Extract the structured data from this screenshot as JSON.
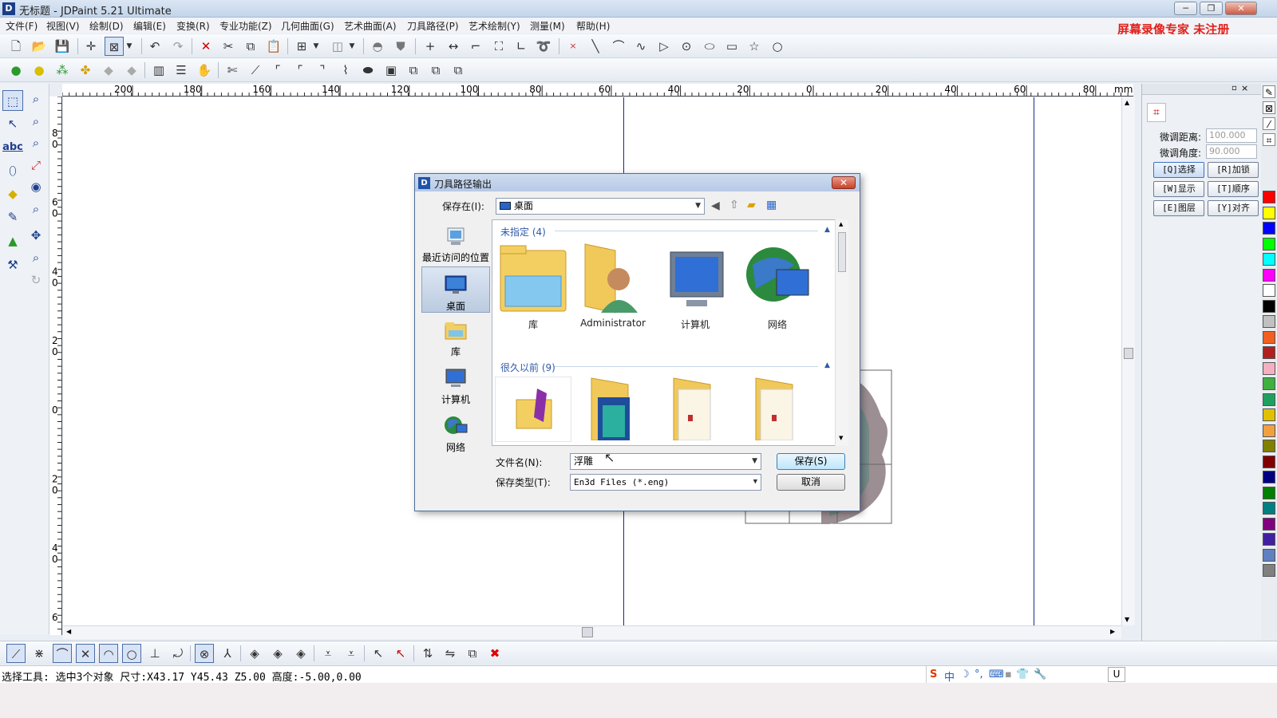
{
  "window": {
    "title": "无标题 - JDPaint 5.21 Ultimate",
    "logo": "D",
    "controls": [
      "─",
      "❐",
      "✕"
    ]
  },
  "menu": [
    "文件(F)",
    "视图(V)",
    "绘制(D)",
    "编辑(E)",
    "变换(R)",
    "专业功能(Z)",
    "几何曲面(G)",
    "艺术曲面(A)",
    "刀具路径(P)",
    "艺术绘制(Y)",
    "测量(M)",
    "帮助(H)"
  ],
  "watermark": "屏幕录像专家  未注册",
  "ruler": {
    "labels": [
      "200",
      "180",
      "160",
      "140",
      "120",
      "100",
      "80",
      "60",
      "40",
      "20",
      "0",
      "20",
      "40",
      "60",
      "80"
    ],
    "unit": "mm",
    "vertical_labels": [
      "8\n0",
      "6\n0",
      "4\n0",
      "2\n0",
      "0",
      "2\n0",
      "4\n0",
      "6"
    ]
  },
  "right_panel": {
    "distance_label": "微调距离:",
    "distance_value": "100.000",
    "angle_label": "微调角度:",
    "angle_value": "90.000",
    "buttons": [
      {
        "label": "[Q]选择",
        "active": true
      },
      {
        "label": "[R]加锁",
        "active": false
      },
      {
        "label": "[W]显示",
        "active": false
      },
      {
        "label": "[T]顺序",
        "active": false
      },
      {
        "label": "[E]图层",
        "active": false
      },
      {
        "label": "[Y]对齐",
        "active": false
      }
    ]
  },
  "palette": [
    "#ff0000",
    "#ffff00",
    "#0000ff",
    "#00ff00",
    "#00ffff",
    "#ff00ff",
    "#ffffff",
    "#000000",
    "#c0c0c0",
    "#f06020",
    "#b02020",
    "#f4b0c0",
    "#40b040",
    "#20a060",
    "#e0c000",
    "#f0a040",
    "#808000",
    "#800000",
    "#000080",
    "#008000",
    "#008080",
    "#800080",
    "#4020a0",
    "#6080c0",
    "#808080"
  ],
  "status": {
    "text": "选择工具: 选中3个对象 尺寸:X43.17 Y45.43 Z5.00 高度:-5.00,0.00",
    "ime_items": [
      "S",
      "中",
      "☽",
      "°,",
      "⌨",
      "▪",
      "👕",
      "🔧"
    ],
    "ime_extra": "U"
  },
  "dialog": {
    "title": "刀具路径输出",
    "icon": "D",
    "close": "✕",
    "save_in_label": "保存在(I):",
    "save_in_value": "桌面",
    "places": [
      "最近访问的位置",
      "桌面",
      "库",
      "计算机",
      "网络"
    ],
    "groups": [
      {
        "header": "未指定 (4)",
        "items": [
          "库",
          "Administrator",
          "计算机",
          "网络"
        ]
      },
      {
        "header": "很久以前 (9)",
        "items": [
          "",
          "",
          "",
          ""
        ]
      }
    ],
    "filename_label": "文件名(N):",
    "filename_value": "浮雕",
    "filetype_label": "保存类型(T):",
    "filetype_value": "En3d Files (*.eng)",
    "save_button": "保存(S)",
    "cancel_button": "取消"
  }
}
